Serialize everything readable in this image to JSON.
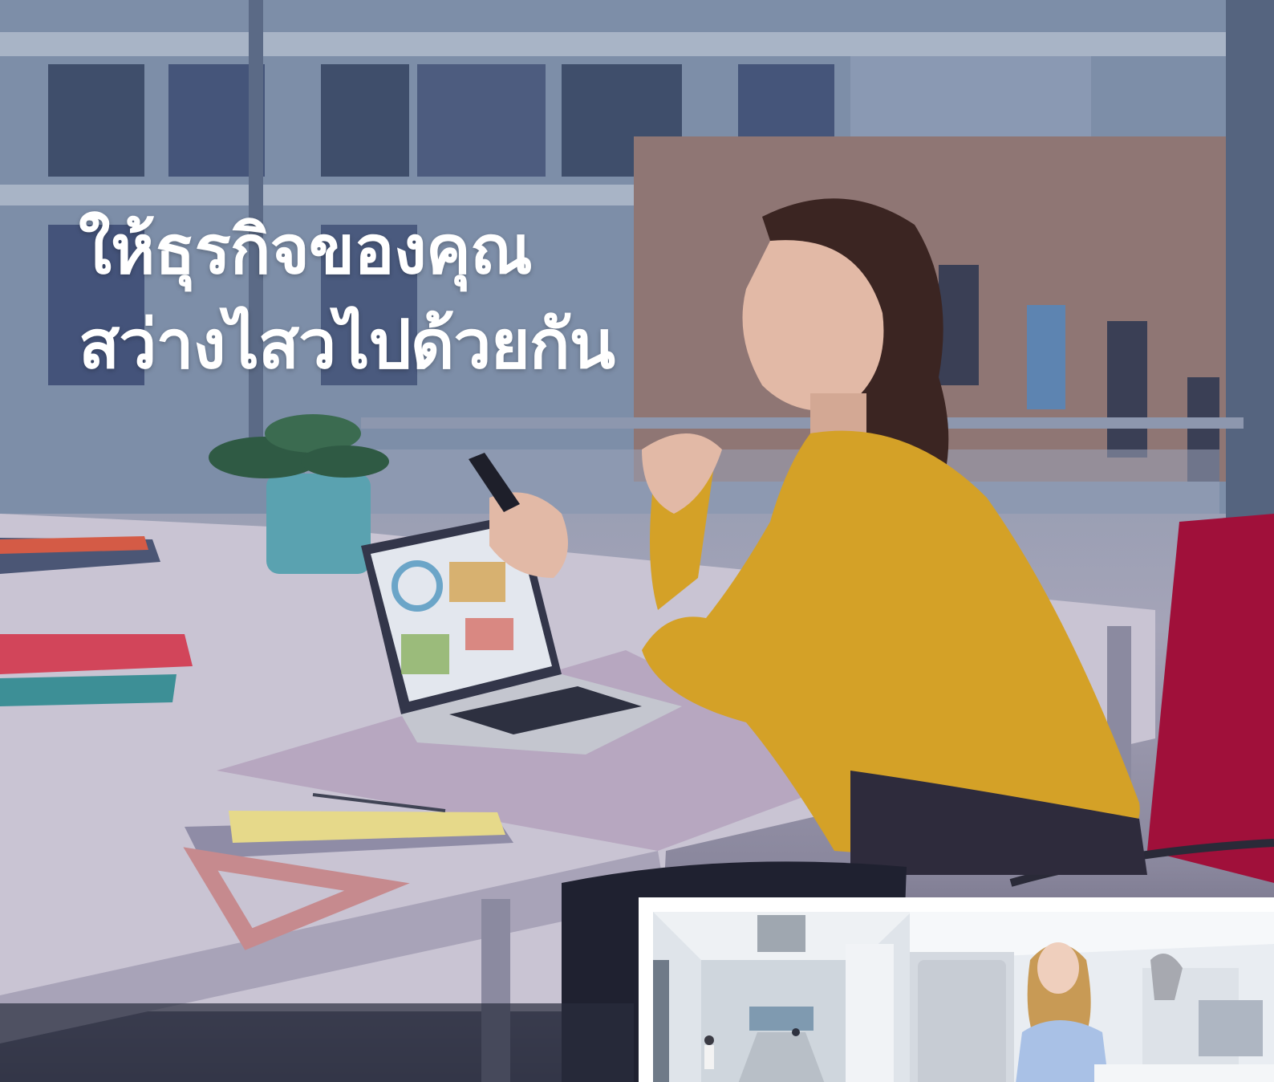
{
  "headline": {
    "line1": "ให้ธุรกิจของคุณ",
    "line2": "สว่างไสวไปด้วยกัน"
  },
  "colors": {
    "headline_text": "#ffffff",
    "blouse": "#d4a127",
    "chair": "#b0103e",
    "desk": "#c9c4d3"
  },
  "images": {
    "main": "woman-at-desk-with-laptop-and-phone-photo",
    "inset_left": "office-lobby-photo",
    "inset_right": "woman-at-computer-photo"
  }
}
